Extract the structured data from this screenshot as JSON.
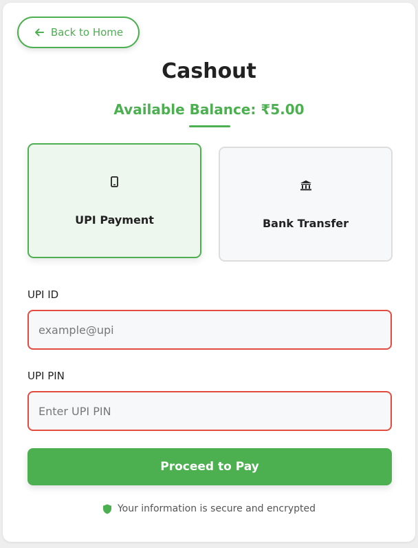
{
  "nav": {
    "back_label": "Back to Home",
    "back_icon": "arrow-left-icon"
  },
  "page": {
    "title": "Cashout",
    "balance_text": "Available Balance: ₹5.00"
  },
  "payment_methods": [
    {
      "label": "UPI Payment",
      "icon": "mobile-phone-icon",
      "selected": true
    },
    {
      "label": "Bank Transfer",
      "icon": "bank-icon",
      "selected": false
    }
  ],
  "form": {
    "upi_id": {
      "label": "UPI ID",
      "placeholder": "example@upi",
      "value": ""
    },
    "upi_pin": {
      "label": "UPI PIN",
      "placeholder": "Enter UPI PIN",
      "value": ""
    },
    "submit_label": "Proceed to Pay"
  },
  "footer": {
    "secure_text": "Your information is secure and encrypted",
    "secure_icon": "shield-icon"
  },
  "colors": {
    "accent": "#4caf50",
    "error_border": "#e34b3f",
    "selected_bg": "#eef7ee"
  }
}
